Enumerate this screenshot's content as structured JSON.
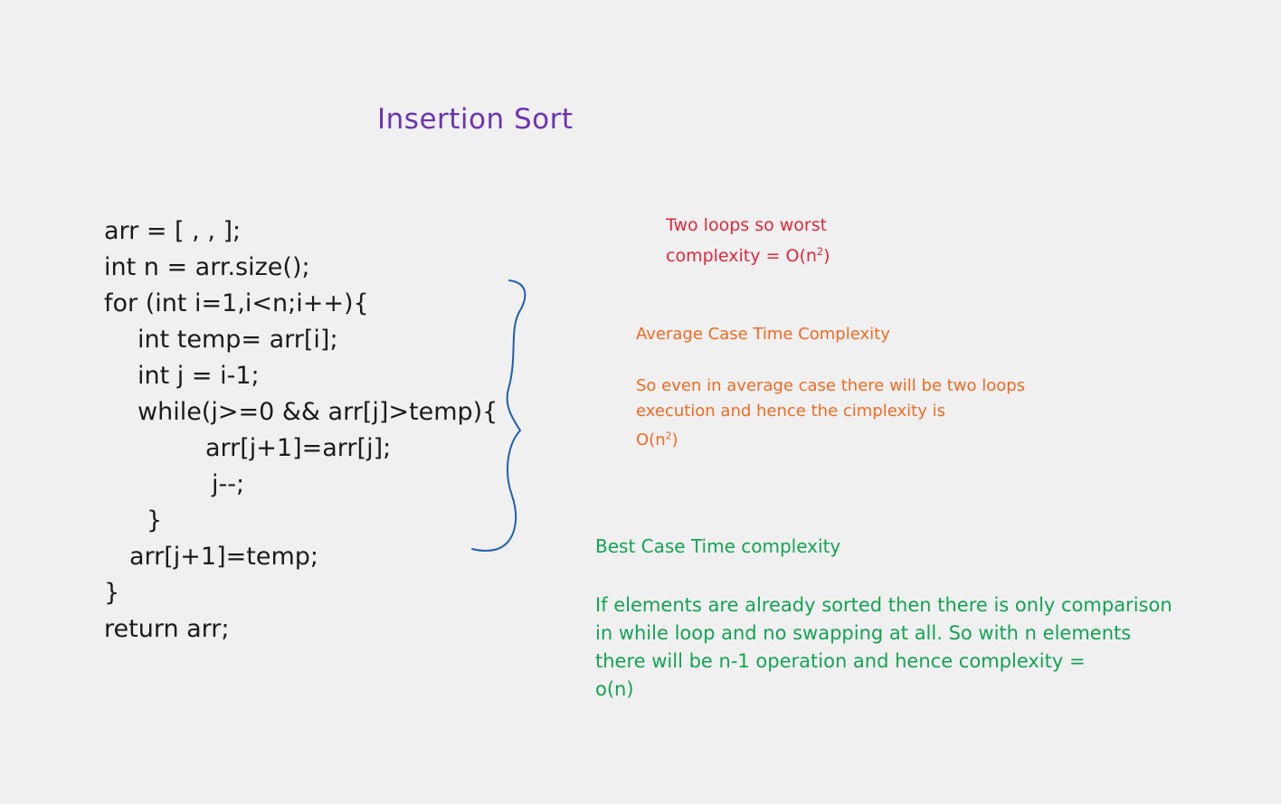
{
  "title": "Insertion Sort",
  "code": {
    "lines": [
      "arr = [ , , ];",
      "int n = arr.size();",
      "for (int i=1,i<n;i++){",
      "int temp= arr[i];",
      "int j = i-1;",
      "while(j>=0 && arr[j]>temp){",
      "arr[j+1]=arr[j];",
      "j--;",
      "}",
      "arr[j+1]=temp;",
      "}",
      "return arr;"
    ]
  },
  "worst_case": {
    "line1": "Two loops so worst",
    "line2_prefix": "complexity = O(n",
    "line2_sup": "2",
    "line2_suffix": ")",
    "color": "#e0283c"
  },
  "average_case": {
    "heading": "Average Case Time Complexity",
    "line1": "So even in average case there will be two loops",
    "line2": "execution and hence the cimplexity is",
    "line3_prefix": "O(n",
    "line3_sup": "2",
    "line3_suffix": ")",
    "color": "#f06a22"
  },
  "best_case": {
    "heading": "Best Case Time complexity",
    "line1": "If elements are already sorted then there is only comparison",
    "line2": "in while loop and no swapping at all. So with n elements",
    "line3": "there will be n-1 operation and hence complexity =",
    "line4": "o(n)",
    "color": "#13a353"
  },
  "brace": {
    "color": "#1f5fb0"
  }
}
